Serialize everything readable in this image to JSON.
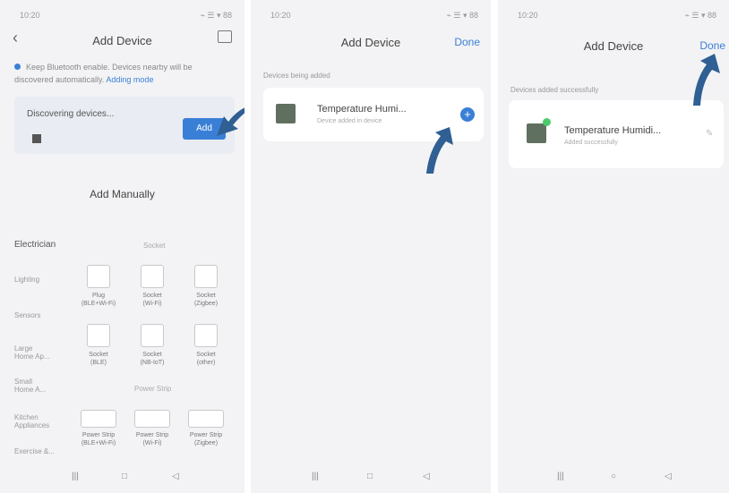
{
  "screen1": {
    "time": "10:20",
    "status_icons": "⌁ ☰  ▾ 88",
    "title": "Add Device",
    "info_text": "Keep Bluetooth enable. Devices nearby will be discovered automatically.",
    "info_link": "Adding mode",
    "discover_title": "Discovering devices...",
    "add_label": "Add",
    "manual_title": "Add Manually",
    "category_main": "Electrician",
    "side_items": [
      "Lighting",
      "Sensors",
      "Large Home Ap...",
      "Small Home A...",
      "Kitchen Appliances",
      "Exercise &..."
    ],
    "sub_headers": [
      "Socket",
      "Power Strip"
    ],
    "tiles": [
      {
        "label": "Plug\n(BLE+Wi-Fi)"
      },
      {
        "label": "Socket\n(Wi-Fi)"
      },
      {
        "label": "Socket\n(Zigbee)"
      },
      {
        "label": "Socket\n(BLE)"
      },
      {
        "label": "Socket\n(NB-IoT)"
      },
      {
        "label": "Socket\n(other)"
      },
      {
        "label": "Power Strip\n(BLE+Wi-Fi)"
      },
      {
        "label": "Power Strip\n(Wi-Fi)"
      },
      {
        "label": "Power Strip\n(Zigbee)"
      }
    ],
    "tabbar": [
      "|||",
      "□",
      "◁"
    ]
  },
  "screen2": {
    "time": "10:20",
    "status_icons": "⌁ ☰  ▾ 88",
    "title": "Add Device",
    "done_label": "Done",
    "group_label": "Devices being added",
    "device_name": "Temperature Humi...",
    "device_sub": "Device added in device",
    "plus_label": "+",
    "tabbar": [
      "|||",
      "□",
      "◁"
    ]
  },
  "screen3": {
    "time": "10:20",
    "status_icons": "⌁ ☰  ▾ 88",
    "title": "Add Device",
    "done_label": "Done",
    "group_label": "Devices added successfully",
    "device_name": "Temperature Humidi...",
    "device_sub": "Added successfully",
    "edit_icon": "✎",
    "tabbar": [
      "|||",
      "○",
      "◁"
    ]
  },
  "colors": {
    "accent": "#3a7fd6",
    "arrow": "#2f5f93",
    "success": "#4ccb6c",
    "background": "#f3f3f5"
  }
}
